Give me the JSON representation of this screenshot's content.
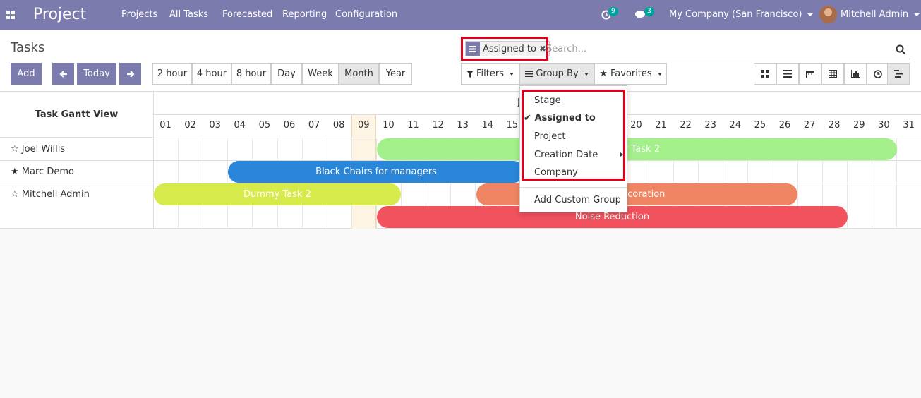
{
  "topbar": {
    "app_name": "Project",
    "menu": [
      "Projects",
      "All Tasks",
      "Forecasted",
      "Reporting",
      "Configuration"
    ],
    "activity_count": "9",
    "message_count": "3",
    "company": "My Company (San Francisco)",
    "user": "Mitchell Admin"
  },
  "control_panel": {
    "title": "Tasks",
    "add_label": "Add",
    "today_label": "Today",
    "scales": [
      "2 hour",
      "4 hour",
      "8 hour",
      "Day",
      "Week",
      "Month",
      "Year"
    ],
    "active_scale": "Month",
    "search": {
      "facet_value": "Assigned to",
      "placeholder": "Search..."
    },
    "filters_label": "Filters",
    "group_by_label": "Group By",
    "favorites_label": "Favorites"
  },
  "group_by_menu": {
    "items": [
      "Stage",
      "Assigned to",
      "Project",
      "Creation Date",
      "Company"
    ],
    "checked": "Assigned to",
    "custom_label": "Add Custom Group"
  },
  "gantt": {
    "title": "Task Gantt View",
    "month_initial": "J",
    "days": [
      "01",
      "02",
      "03",
      "04",
      "05",
      "06",
      "07",
      "08",
      "09",
      "10",
      "11",
      "12",
      "13",
      "14",
      "15",
      "16",
      "17",
      "18",
      "19",
      "20",
      "21",
      "22",
      "23",
      "24",
      "25",
      "26",
      "27",
      "28",
      "29",
      "30",
      "31"
    ],
    "today_day": "09",
    "rows": [
      {
        "name": "Joel Willis",
        "starred": false
      },
      {
        "name": "Marc Demo",
        "starred": true
      },
      {
        "name": "Mitchell Admin",
        "starred": false
      }
    ],
    "tasks": [
      {
        "label": "my Task 2",
        "color": "#a3f08a"
      },
      {
        "label": "Black Chairs for managers",
        "color": "#2a86d9"
      },
      {
        "label": "Dummy Task 2",
        "color": "#d7ea4b"
      },
      {
        "label": ": Decoration",
        "color": "#ef8563"
      },
      {
        "label": "Noise Reduction",
        "color": "#f2515e"
      }
    ]
  }
}
